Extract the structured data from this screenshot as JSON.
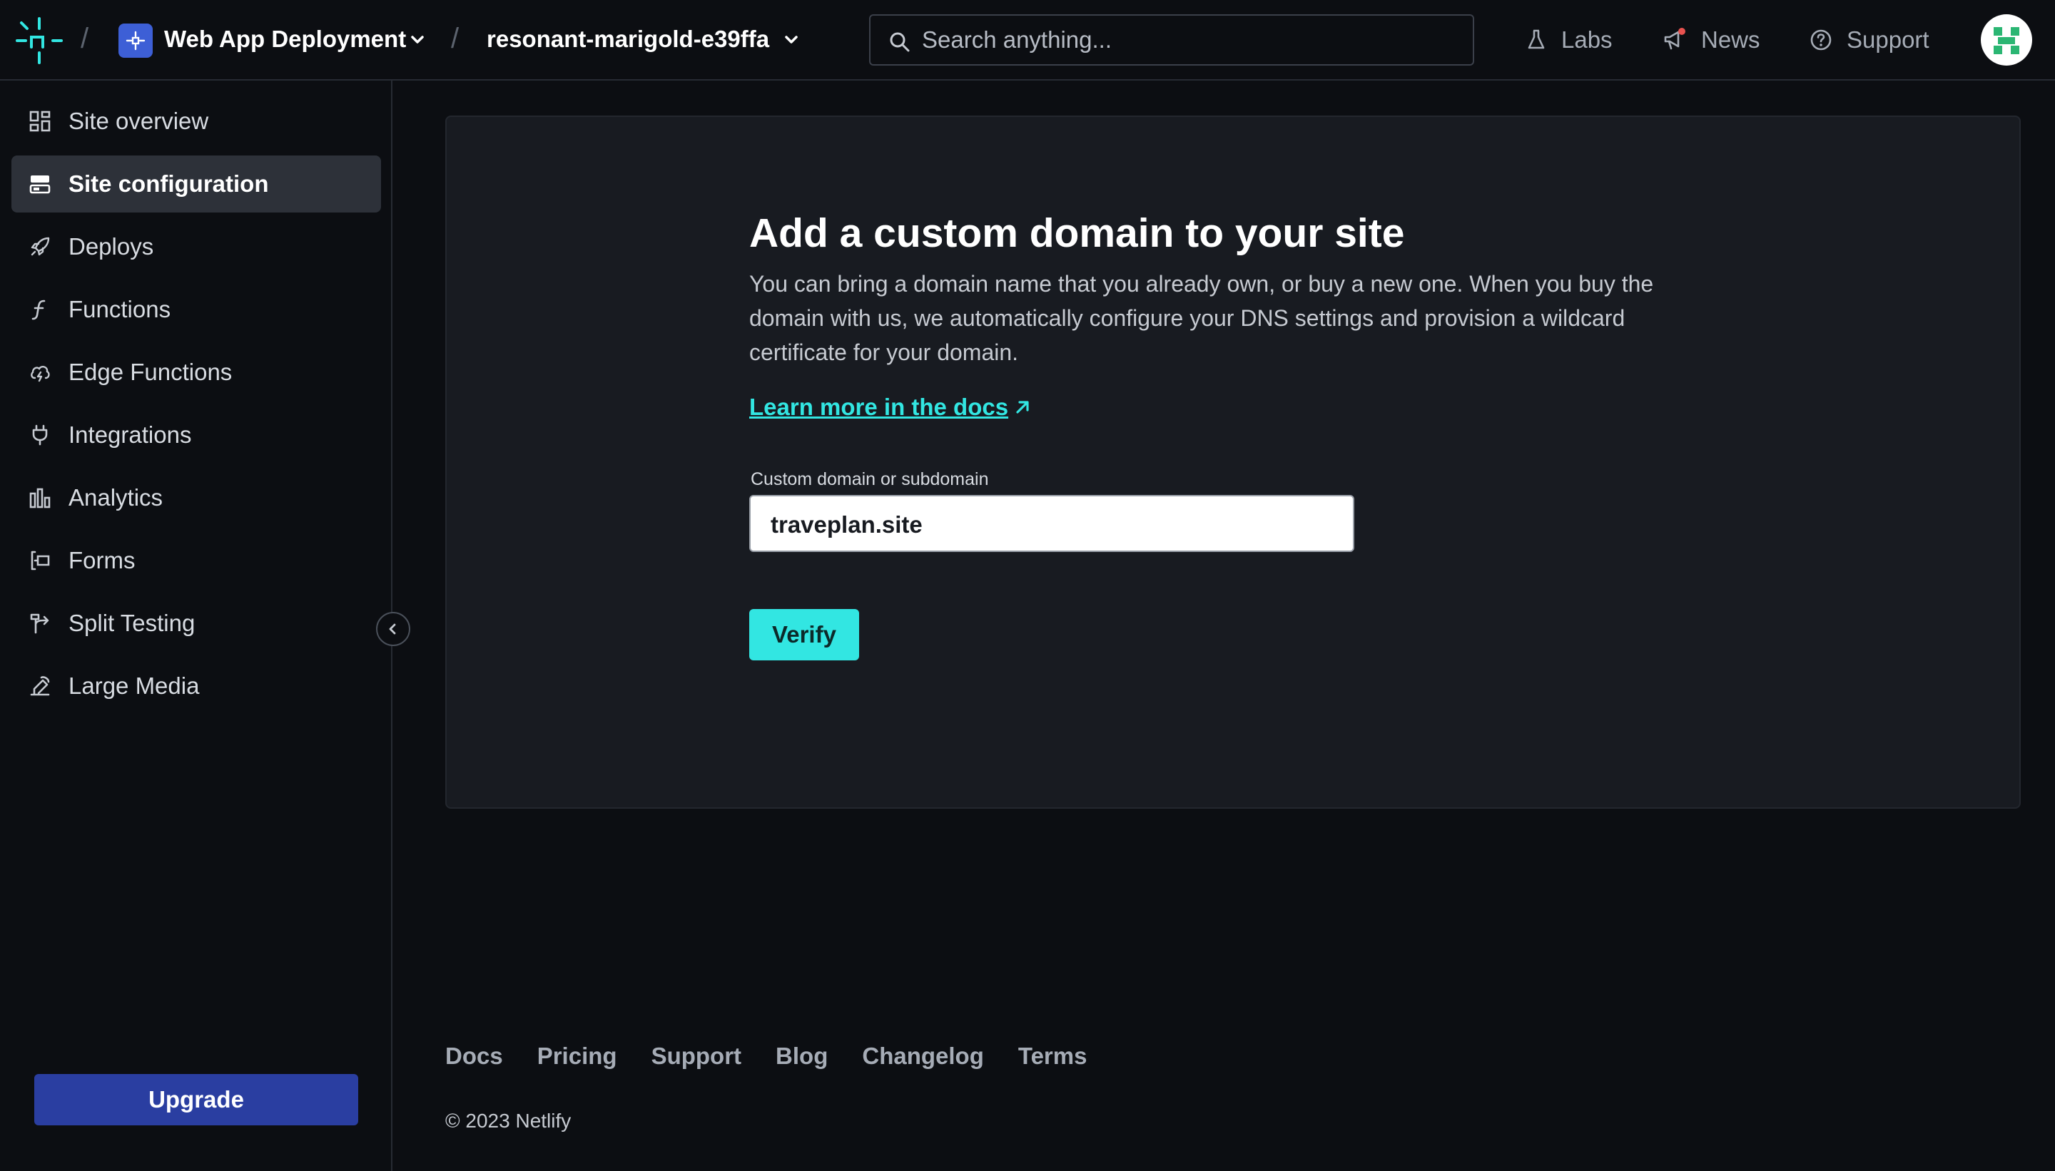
{
  "header": {
    "team_name": "Web App Deployment",
    "site_name": "resonant-marigold-e39ffa",
    "separator": "/",
    "search": {
      "placeholder": "Search anything..."
    },
    "nav": [
      {
        "label": "Labs",
        "icon": "flask-icon"
      },
      {
        "label": "News",
        "icon": "megaphone-icon"
      },
      {
        "label": "Support",
        "icon": "help-circle-icon"
      }
    ]
  },
  "sidebar": {
    "items": [
      {
        "label": "Site overview",
        "icon": "grid-icon",
        "active": false
      },
      {
        "label": "Site configuration",
        "icon": "server-icon",
        "active": true
      },
      {
        "label": "Deploys",
        "icon": "rocket-icon",
        "active": false
      },
      {
        "label": "Functions",
        "icon": "lambda-icon",
        "active": false
      },
      {
        "label": "Edge Functions",
        "icon": "cloud-bolt-icon",
        "active": false
      },
      {
        "label": "Integrations",
        "icon": "plug-icon",
        "active": false
      },
      {
        "label": "Analytics",
        "icon": "bar-chart-icon",
        "active": false
      },
      {
        "label": "Forms",
        "icon": "form-icon",
        "active": false
      },
      {
        "label": "Split Testing",
        "icon": "split-icon",
        "active": false
      },
      {
        "label": "Large Media",
        "icon": "media-icon",
        "active": false
      }
    ],
    "upgrade_label": "Upgrade"
  },
  "main": {
    "title": "Add a custom domain to your site",
    "description": "You can bring a domain name that you already own, or buy a new one. When you buy the domain with us, we automatically configure your DNS settings and provision a wildcard certificate for your domain.",
    "learn_more": "Learn more in the docs",
    "field_label": "Custom domain or subdomain",
    "field_value": "traveplan.site",
    "verify_label": "Verify"
  },
  "footer": {
    "links": [
      "Docs",
      "Pricing",
      "Support",
      "Blog",
      "Changelog",
      "Terms"
    ],
    "copyright": "© 2023 Netlify"
  },
  "colors": {
    "background": "#0c0e12",
    "card": "#181b21",
    "accent_teal": "#32e6e2",
    "upgrade_blue": "#2a3ea1",
    "team_icon_blue": "#3d5fd6",
    "news_dot": "#e8524f"
  }
}
